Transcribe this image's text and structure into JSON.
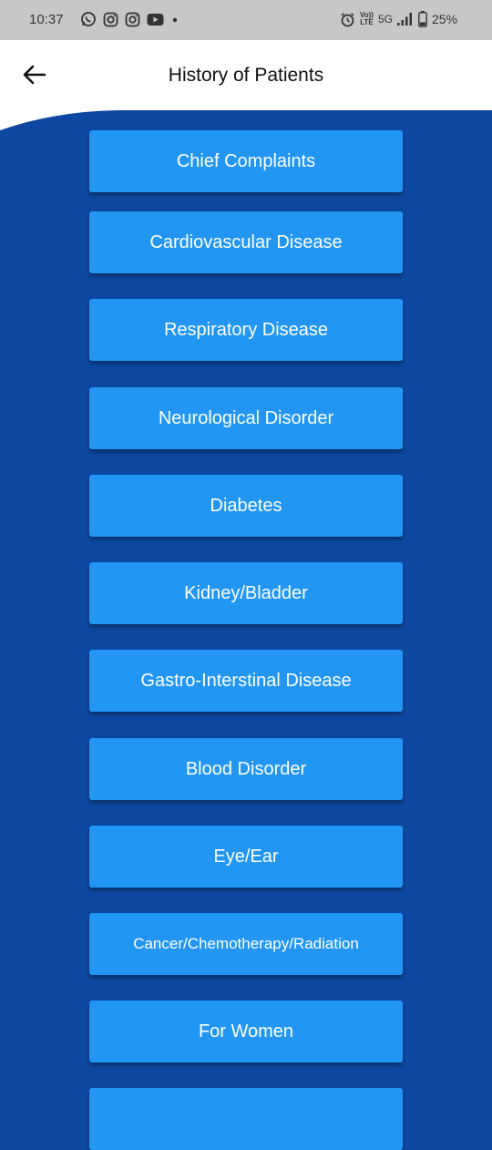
{
  "status_bar": {
    "time": "10:37",
    "network": "5G",
    "volte_top": "Vo))",
    "volte_bottom": "LTE",
    "battery": "25%"
  },
  "header": {
    "title": "History of Patients"
  },
  "menu": {
    "items": [
      {
        "label": "Chief Complaints"
      },
      {
        "label": "Cardiovascular Disease"
      },
      {
        "label": "Respiratory Disease"
      },
      {
        "label": "Neurological Disorder"
      },
      {
        "label": "Diabetes"
      },
      {
        "label": "Kidney/Bladder"
      },
      {
        "label": "Gastro-Interstinal Disease"
      },
      {
        "label": "Blood Disorder"
      },
      {
        "label": "Eye/Ear"
      },
      {
        "label": "Cancer/Chemotherapy/Radiation"
      },
      {
        "label": "For Women"
      }
    ]
  },
  "colors": {
    "background": "#0d47a1",
    "button": "#2196f3",
    "status_bar": "#c7c7c7"
  }
}
